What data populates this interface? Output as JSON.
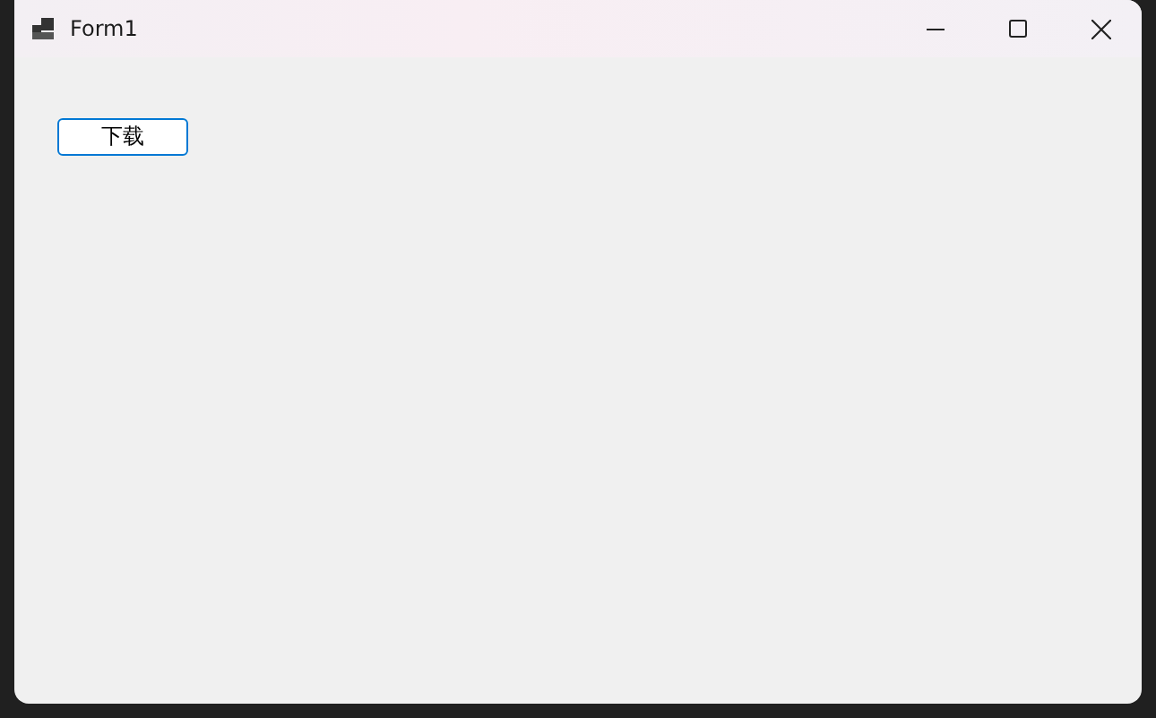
{
  "window": {
    "title": "Form1"
  },
  "buttons": [
    {
      "label": "下载",
      "focused": true
    }
  ]
}
